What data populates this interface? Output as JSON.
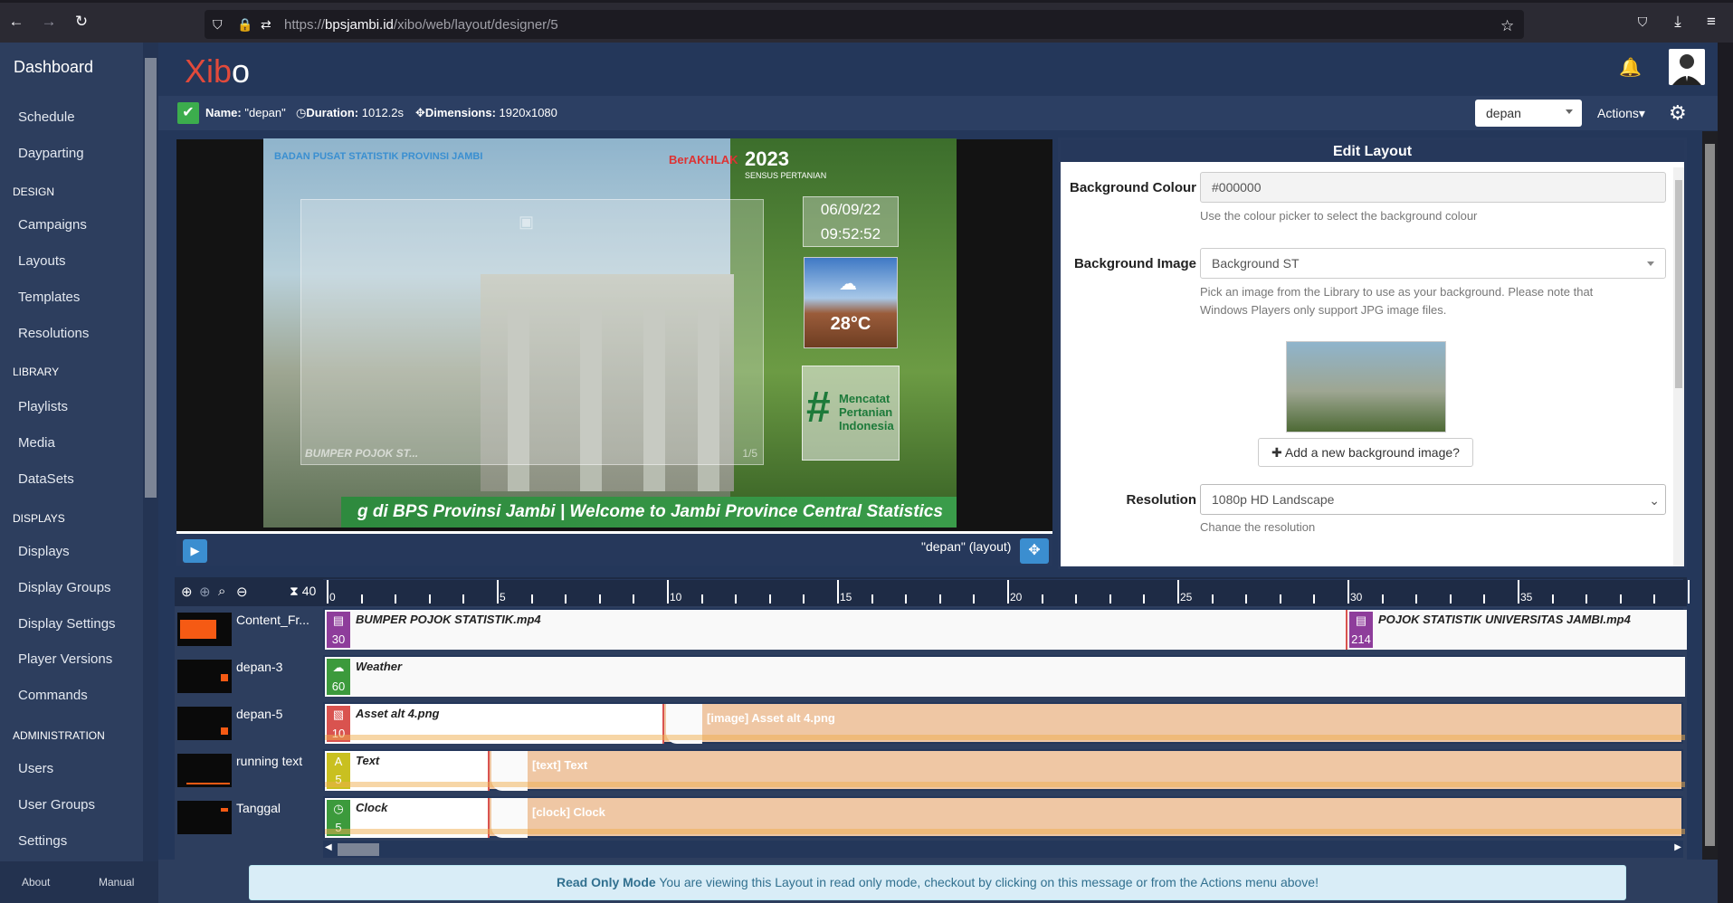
{
  "browser": {
    "url_domain": "bpsjambi.id",
    "url_path": "/xibo/web/layout/designer/5"
  },
  "sidebar": {
    "title": "Dashboard",
    "items": [
      {
        "label": "Schedule"
      },
      {
        "label": "Dayparting"
      },
      {
        "label": "DESIGN",
        "header": true
      },
      {
        "label": "Campaigns"
      },
      {
        "label": "Layouts"
      },
      {
        "label": "Templates"
      },
      {
        "label": "Resolutions"
      },
      {
        "label": "LIBRARY",
        "header": true
      },
      {
        "label": "Playlists"
      },
      {
        "label": "Media"
      },
      {
        "label": "DataSets"
      },
      {
        "label": "DISPLAYS",
        "header": true
      },
      {
        "label": "Displays"
      },
      {
        "label": "Display Groups"
      },
      {
        "label": "Display Settings"
      },
      {
        "label": "Player Versions"
      },
      {
        "label": "Commands"
      },
      {
        "label": "ADMINISTRATION",
        "header": true
      },
      {
        "label": "Users"
      },
      {
        "label": "User Groups"
      },
      {
        "label": "Settings"
      }
    ],
    "footer": {
      "about": "About",
      "manual": "Manual"
    }
  },
  "header": {
    "logo_x": "Xib",
    "logo_o": "o"
  },
  "infobar": {
    "name_label": "Name:",
    "name_value": "\"depan\"",
    "duration_label": "Duration:",
    "duration_value": "1012.2s",
    "dimensions_label": "Dimensions:",
    "dimensions_value": "1920x1080",
    "layout_select": "depan",
    "actions": "Actions"
  },
  "preview": {
    "region_label": "BUMPER POJOK ST...",
    "region_page": "1/5",
    "date": "06/09/22",
    "time": "09:52:52",
    "temp": "28°C",
    "hashtag": "#",
    "hashtag_words": [
      "Mencatat",
      "Pertanian",
      "Indonesia"
    ],
    "ticker": "g di BPS Provinsi Jambi | Welcome to Jambi Province Central Statistics",
    "logo_left": "BADAN PUSAT STATISTIK PROVINSI JAMBI",
    "logo_mid": "BerAKHLAK",
    "logo_right": "2023",
    "logo_right_sub": "SENSUS PERTANIAN",
    "layout_label": "\"depan\" (layout)"
  },
  "edit_panel": {
    "title": "Edit Layout",
    "bg_colour_label": "Background Colour",
    "bg_colour_value": "#000000",
    "bg_colour_help": "Use the colour picker to select the background colour",
    "bg_image_label": "Background Image",
    "bg_image_value": "Background ST",
    "bg_image_help_1": "Pick an image from the Library to use as your background. Please note that",
    "bg_image_help_2": "Windows Players only support JPG image files.",
    "add_bg_button": "Add a new background image?",
    "resolution_label": "Resolution",
    "resolution_value": "1080p HD Landscape",
    "resolution_help": "Change the resolution"
  },
  "timeline": {
    "zoom_value": "40",
    "ruler_labels": [
      "0",
      "5",
      "10",
      "15",
      "20",
      "25",
      "30",
      "35"
    ],
    "rows": [
      {
        "name": "Content_Fr...",
        "widgets": [
          {
            "name": "BUMPER POJOK STATISTIK.mp4",
            "duration": "30",
            "color": "#8e3d9b"
          },
          {
            "name": "POJOK STATISTIK UNIVERSITAS JAMBI.mp4",
            "duration": "214",
            "color": "#8e3d9b"
          }
        ]
      },
      {
        "name": "depan-3",
        "widgets": [
          {
            "name": "Weather",
            "duration": "60",
            "color": "#3c9a3c"
          }
        ]
      },
      {
        "name": "depan-5",
        "widgets": [
          {
            "name": "Asset alt 4.png",
            "duration": "10",
            "color": "#d9534f"
          }
        ],
        "ghost": "[image] Asset alt 4.png"
      },
      {
        "name": "running text",
        "widgets": [
          {
            "name": "Text",
            "duration": "5",
            "color": "#c9c020"
          }
        ],
        "ghost": "[text] Text"
      },
      {
        "name": "Tanggal",
        "widgets": [
          {
            "name": "Clock",
            "duration": "5",
            "color": "#3c9a3c"
          }
        ],
        "ghost": "[clock] Clock"
      }
    ]
  },
  "banner": {
    "bold": "Read Only Mode",
    "text": " You are viewing this Layout in read only mode, checkout by clicking on this message or from the Actions menu above!"
  },
  "colors": {
    "sidebar": "#2d3e5e",
    "main": "#24375a",
    "accent_blue": "#3b8ed0",
    "logo_red": "#e24a3b"
  }
}
